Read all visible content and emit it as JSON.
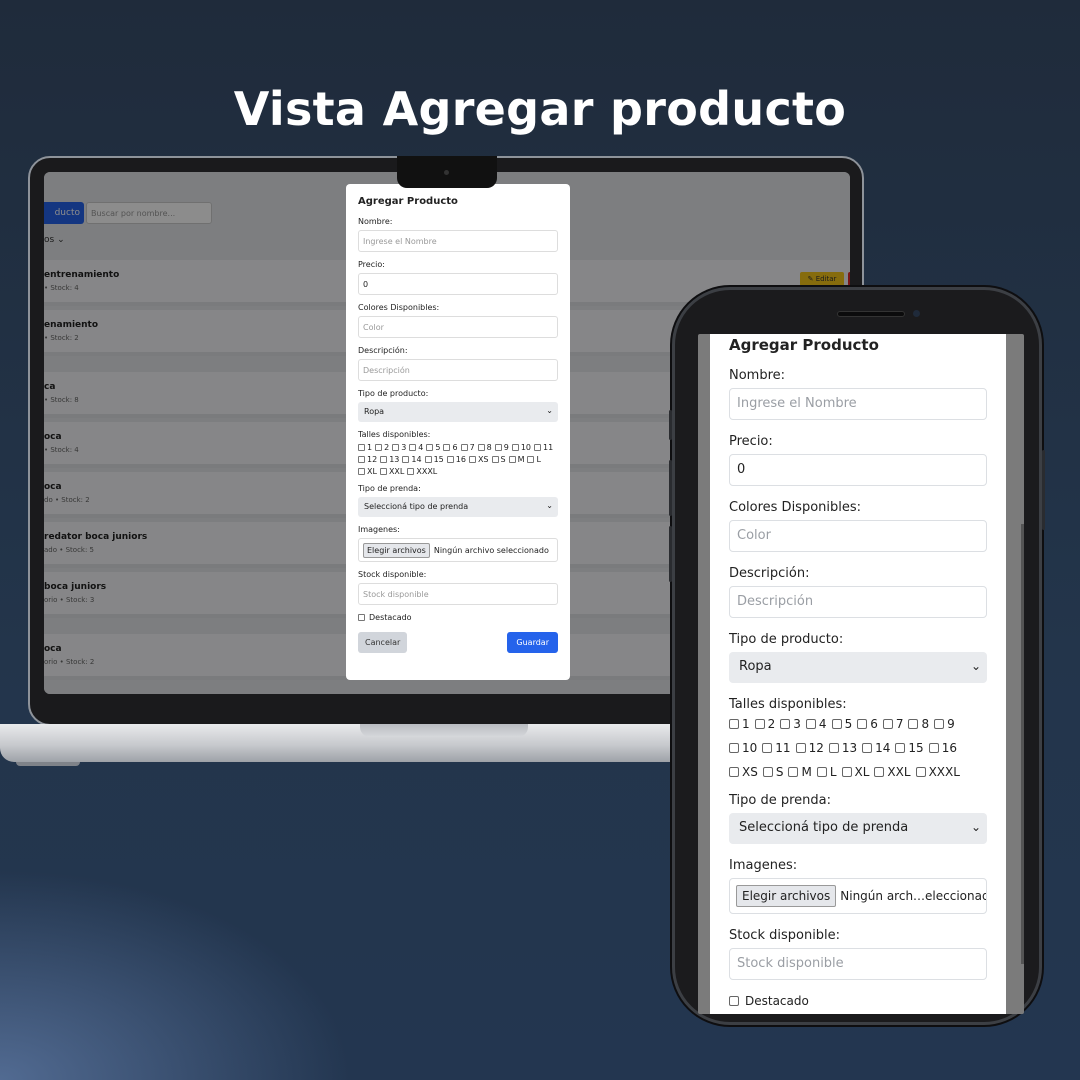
{
  "headline": "Vista Agregar producto",
  "background_app": {
    "add_button": "ducto",
    "search_placeholder": "Buscar por nombre...",
    "filter_label": "os",
    "edit_label": "Editar",
    "rows": [
      {
        "title": "entrenamiento",
        "subtitle": "• Stock: 4"
      },
      {
        "title": "enamiento",
        "subtitle": "• Stock: 2"
      },
      {
        "title": "ca",
        "subtitle": "• Stock: 8"
      },
      {
        "title": "oca",
        "subtitle": "• Stock: 4"
      },
      {
        "title": "oca",
        "subtitle": "do • Stock: 2"
      },
      {
        "title": "redator boca juniors",
        "subtitle": "ado • Stock: 5"
      },
      {
        "title": " boca juniors",
        "subtitle": "orio • Stock: 3"
      },
      {
        "title": "oca",
        "subtitle": "orio • Stock: 2"
      }
    ]
  },
  "modal": {
    "title": "Agregar Producto",
    "name_label": "Nombre:",
    "name_placeholder": "Ingrese el Nombre",
    "price_label": "Precio:",
    "price_value": "0",
    "colors_label": "Colores Disponibles:",
    "colors_placeholder": "Color",
    "description_label": "Descripción:",
    "description_placeholder": "Descripción",
    "product_type_label": "Tipo de producto:",
    "product_type_value": "Ropa",
    "sizes_label": "Talles disponibles:",
    "sizes": [
      "1",
      "2",
      "3",
      "4",
      "5",
      "6",
      "7",
      "8",
      "9",
      "10",
      "11",
      "12",
      "13",
      "14",
      "15",
      "16",
      "XS",
      "S",
      "M",
      "L",
      "XL",
      "XXL",
      "XXXL"
    ],
    "garment_type_label": "Tipo de prenda:",
    "garment_type_value": "Seleccioná tipo de prenda",
    "images_label": "Imagenes:",
    "file_button": "Elegir archivos",
    "file_status": "Ningún archivo seleccionado",
    "file_status_short": "Ningún arch…eleccionado",
    "stock_label": "Stock disponible:",
    "stock_placeholder": "Stock disponible",
    "featured_label": "Destacado",
    "cancel_button": "Cancelar",
    "save_button": "Guardar"
  },
  "colors": {
    "primary": "#2563eb",
    "warning": "#f5c518",
    "danger": "#dc2626"
  }
}
